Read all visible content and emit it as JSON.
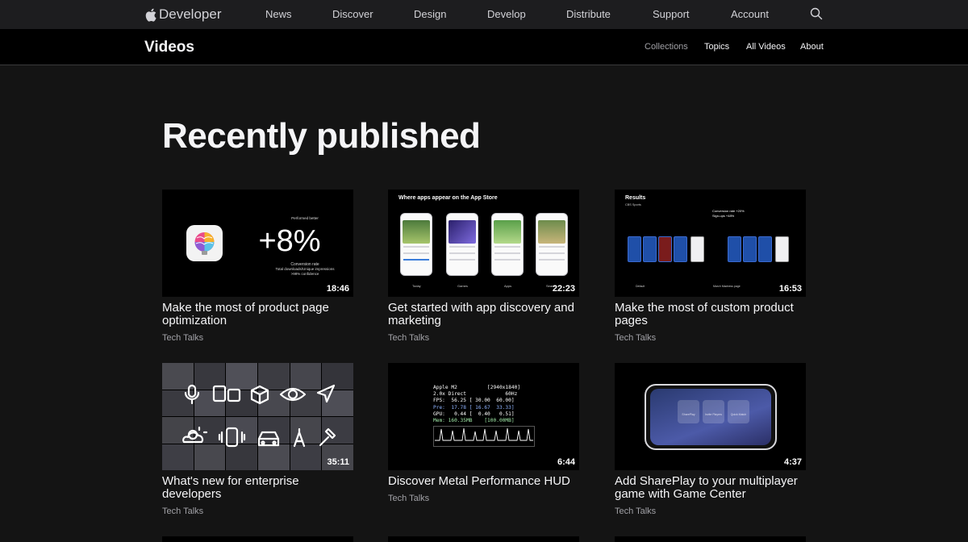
{
  "globalnav": {
    "logo_text": "Developer",
    "items": [
      "News",
      "Discover",
      "Design",
      "Develop",
      "Distribute",
      "Support",
      "Account"
    ]
  },
  "localnav": {
    "title": "Videos",
    "items": [
      "Collections",
      "Topics",
      "All Videos",
      "About"
    ],
    "current": "Collections"
  },
  "section": {
    "heading": "Recently published"
  },
  "videos": [
    {
      "title": "Make the most of product page optimization",
      "category": "Tech Talks",
      "duration": "18:46",
      "thumb": {
        "top_label": "Performed better",
        "big_value": "+8%",
        "lines": [
          "Conversion rate",
          "Total downloads/Unique impressions",
          ">98% confidence"
        ]
      }
    },
    {
      "title": "Get started with app discovery and marketing",
      "category": "Tech Talks",
      "duration": "22:23",
      "thumb": {
        "caption": "Where apps appear on the App Store",
        "labels": [
          "Today",
          "Games",
          "Apps",
          "Search"
        ]
      }
    },
    {
      "title": "Make the most of custom product pages",
      "category": "Tech Talks",
      "duration": "16:53",
      "thumb": {
        "caption": "Results",
        "sub": "CBS Sports",
        "metrics": [
          "Conversion rate +20%",
          "Sign-ups +48%"
        ],
        "labels": [
          "Default",
          "March Madness page"
        ]
      }
    },
    {
      "title": "What's new for enterprise developers",
      "category": "Tech Talks",
      "duration": "35:11"
    },
    {
      "title": "Discover Metal Performance HUD",
      "category": "Tech Talks",
      "duration": "6:44",
      "thumb": {
        "hud_lines": [
          "Apple M2          [2940x1840]",
          "2.0x Direct             60Hz",
          "FPS:  56.25 [ 30.00  60.00]",
          "Pre:  17.78 [ 16.67  33.33]",
          "GPU:   0.44 [  0.40   0.51]",
          "Mem: 160.35MB    [100.00MB]"
        ]
      }
    },
    {
      "title": "Add SharePlay to your multiplayer game with Game Center",
      "category": "Tech Talks",
      "duration": "4:37",
      "thumb": {
        "buttons": [
          "SharePlay",
          "Invite Players",
          "Quick Match"
        ]
      }
    }
  ]
}
